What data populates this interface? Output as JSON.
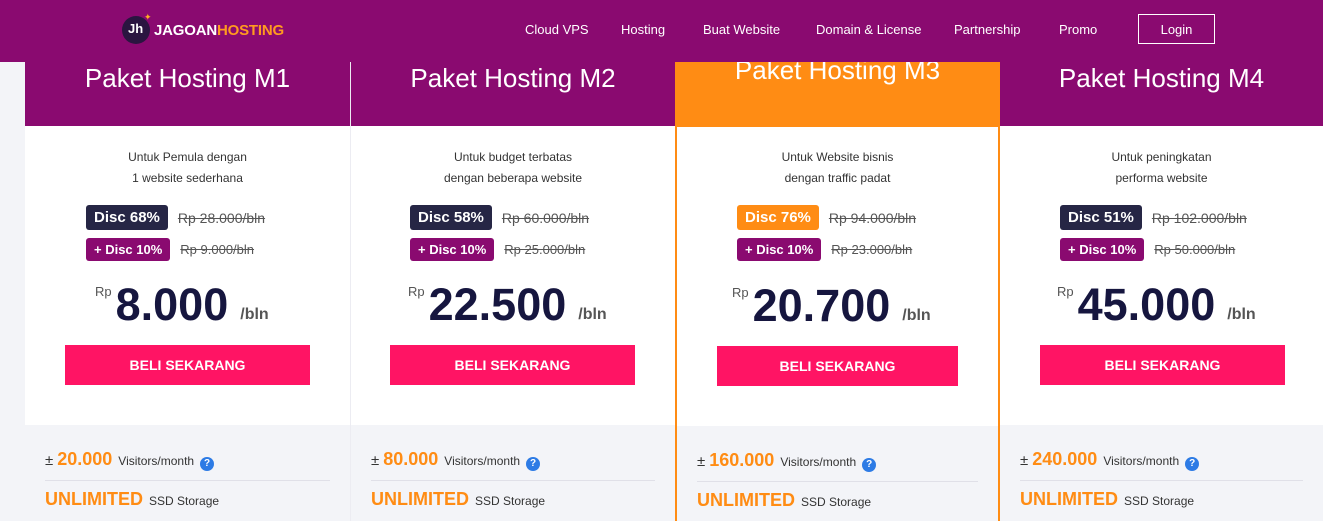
{
  "nav": {
    "logo_part1": "JAGOAN",
    "logo_part2": "HOSTING",
    "logo_mark": "Jh",
    "links": [
      "Cloud VPS",
      "Hosting",
      "Buat Website",
      "Domain & License",
      "Partnership",
      "Promo"
    ],
    "login_label": "Login"
  },
  "plans": [
    {
      "title": "Paket Hosting M1",
      "desc_line1": "Untuk Pemula dengan",
      "desc_line2": "1 website sederhana",
      "disc": "Disc 68%",
      "old_price": "Rp 28.000/bln",
      "extra_disc": "+ Disc 10%",
      "extra_old_price": "Rp 9.000/bln",
      "currency": "Rp",
      "price": "8.000",
      "period": "/bln",
      "cta": "BELI SEKARANG",
      "visitors_prefix": "±",
      "visitors": "20.000",
      "visitors_label": "Visitors/month",
      "storage": "UNLIMITED",
      "storage_label": "SSD Storage"
    },
    {
      "title": "Paket Hosting M2",
      "desc_line1": "Untuk budget terbatas",
      "desc_line2": "dengan beberapa website",
      "disc": "Disc 58%",
      "old_price": "Rp 60.000/bln",
      "extra_disc": "+ Disc 10%",
      "extra_old_price": "Rp 25.000/bln",
      "currency": "Rp",
      "price": "22.500",
      "period": "/bln",
      "cta": "BELI SEKARANG",
      "visitors_prefix": "±",
      "visitors": "80.000",
      "visitors_label": "Visitors/month",
      "storage": "UNLIMITED",
      "storage_label": "SSD Storage"
    },
    {
      "title": "Paket Hosting M3",
      "desc_line1": "Untuk Website bisnis",
      "desc_line2": "dengan traffic padat",
      "disc": "Disc 76%",
      "old_price": "Rp 94.000/bln",
      "extra_disc": "+ Disc 10%",
      "extra_old_price": "Rp 23.000/bln",
      "currency": "Rp",
      "price": "20.700",
      "period": "/bln",
      "cta": "BELI SEKARANG",
      "visitors_prefix": "±",
      "visitors": "160.000",
      "visitors_label": "Visitors/month",
      "storage": "UNLIMITED",
      "storage_label": "SSD Storage"
    },
    {
      "title": "Paket Hosting M4",
      "desc_line1": "Untuk peningkatan",
      "desc_line2": "performa website",
      "disc": "Disc 51%",
      "old_price": "Rp 102.000/bln",
      "extra_disc": "+ Disc 10%",
      "extra_old_price": "Rp 50.000/bln",
      "currency": "Rp",
      "price": "45.000",
      "period": "/bln",
      "cta": "BELI SEKARANG",
      "visitors_prefix": "±",
      "visitors": "240.000",
      "visitors_label": "Visitors/month",
      "storage": "UNLIMITED",
      "storage_label": "SSD Storage"
    }
  ],
  "help_glyph": "?",
  "colors": {
    "brand_purple": "#8a0a70",
    "accent_orange": "#ff8c14",
    "cta_pink": "#ff1464",
    "badge_navy": "#262645"
  },
  "icons": [
    "logo-mark-icon",
    "help-icon"
  ]
}
